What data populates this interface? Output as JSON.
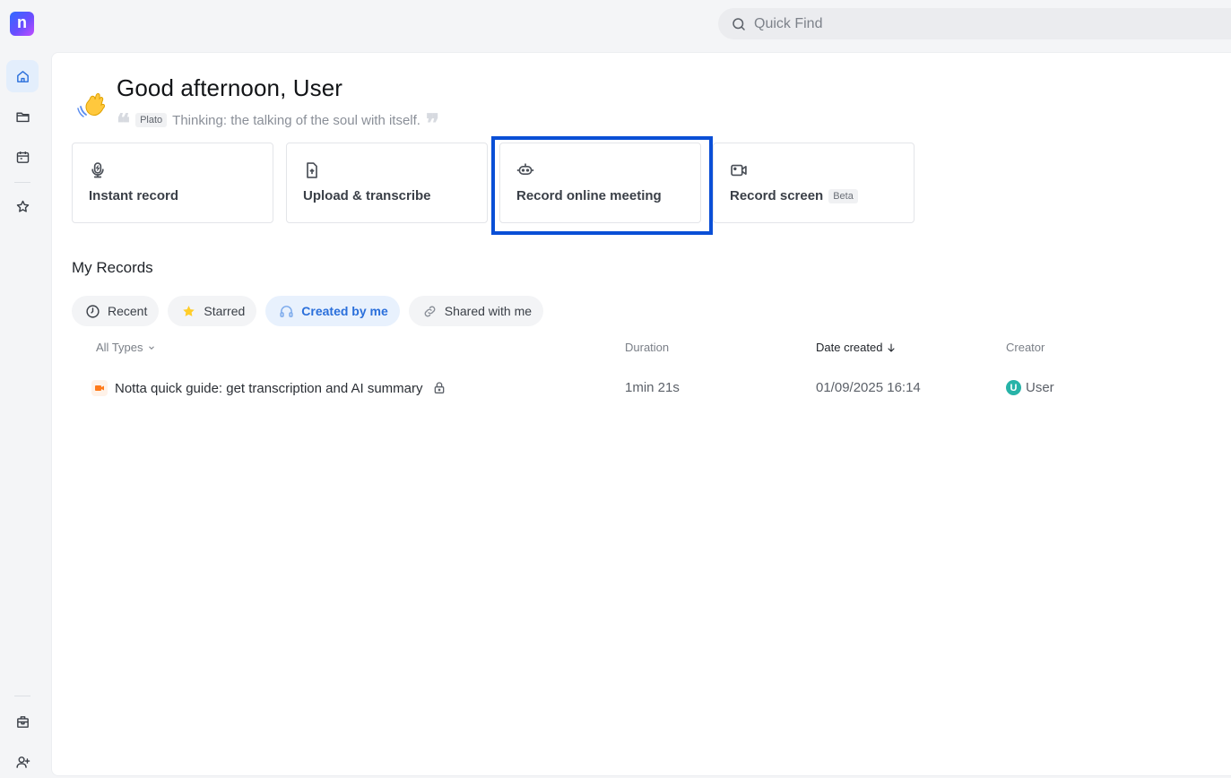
{
  "brand": {
    "logo_letter": "n"
  },
  "search": {
    "placeholder": "Quick Find"
  },
  "home": {
    "greeting": "Good afternoon, User",
    "quote": {
      "author": "Plato",
      "text": "Thinking: the talking of the soul with itself.",
      "open_mark": "❝",
      "close_mark": "❞"
    }
  },
  "actions": [
    {
      "label": "Instant record",
      "icon": "microphone-icon"
    },
    {
      "label": "Upload & transcribe",
      "icon": "file-upload-icon"
    },
    {
      "label": "Record online meeting",
      "icon": "meeting-bot-icon"
    },
    {
      "label": "Record screen",
      "icon": "video-camera-icon",
      "badge": "Beta"
    }
  ],
  "records": {
    "title": "My Records",
    "tabs": [
      {
        "label": "Recent",
        "icon": "clock-icon"
      },
      {
        "label": "Starred",
        "icon": "star-icon"
      },
      {
        "label": "Created by me",
        "icon": "headphones-icon",
        "active": true
      },
      {
        "label": "Shared with me",
        "icon": "link-icon"
      }
    ],
    "columns": {
      "type": "All Types",
      "duration": "Duration",
      "date": "Date created",
      "creator": "Creator"
    },
    "rows": [
      {
        "title": "Notta quick guide: get transcription and AI summary",
        "duration": "1min 21s",
        "date": "01/09/2025 16:14",
        "creator": "User",
        "creator_initial": "U"
      }
    ]
  },
  "colors": {
    "accent": "#2a6fdb",
    "highlight": "#0a4fd6",
    "avatar": "#27b3a8"
  }
}
